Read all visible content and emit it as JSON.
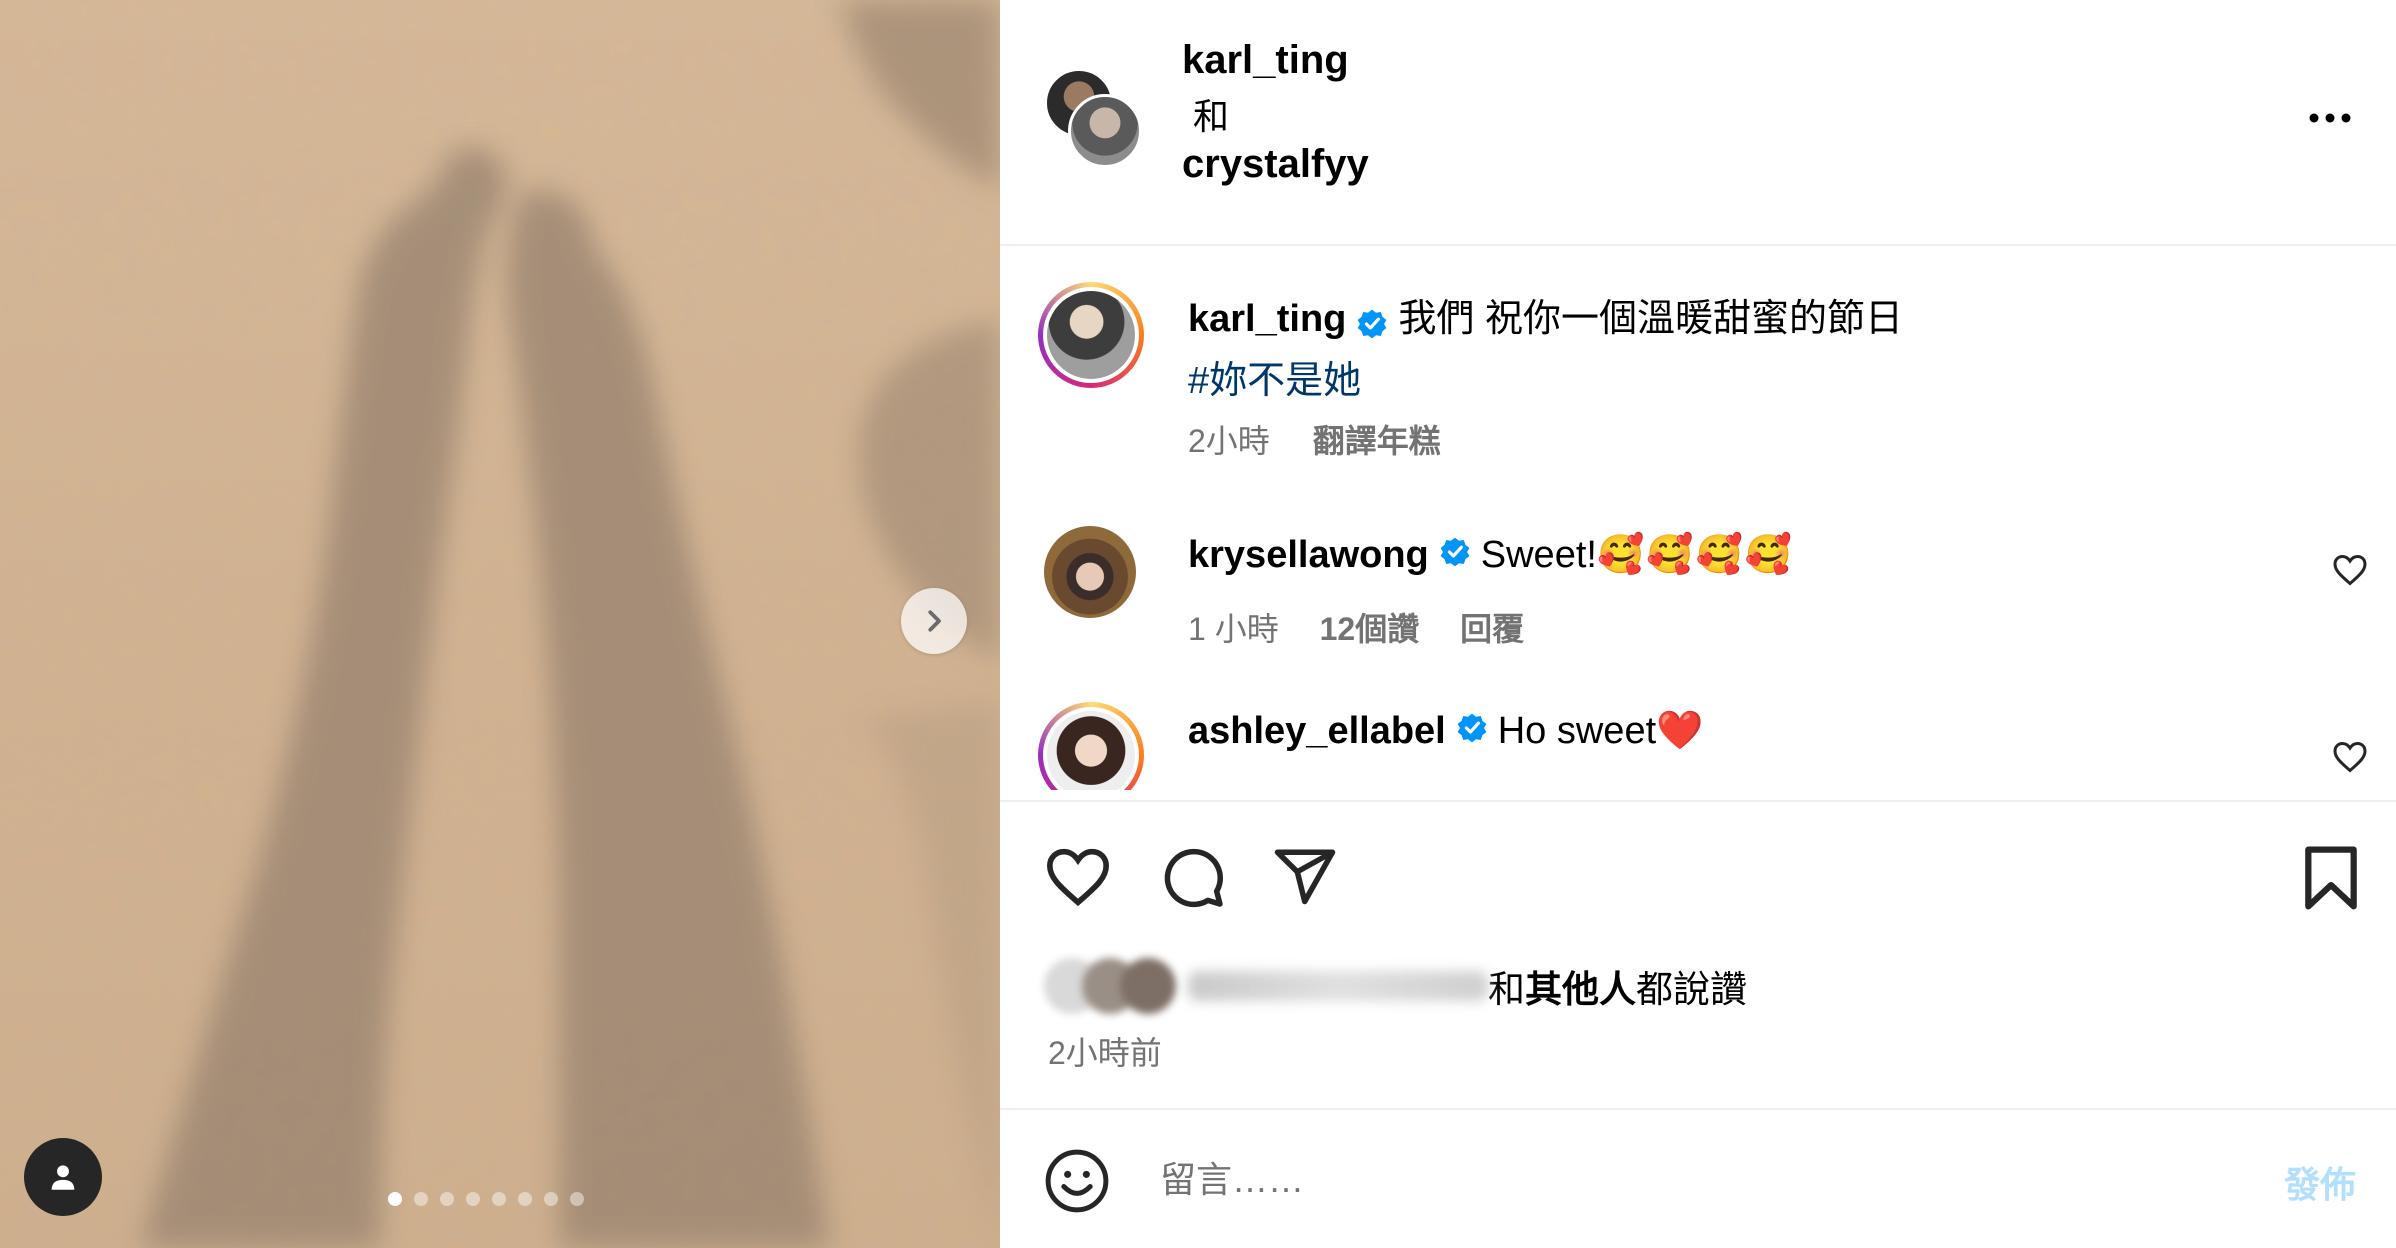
{
  "header": {
    "user1": "karl_ting",
    "and": "和",
    "user2": "crystalfyy"
  },
  "caption": {
    "username": "karl_ting",
    "text": "我們 祝你一個溫暖甜蜜的節日",
    "hashtag": "#妳不是她",
    "time": "2小時",
    "translate": "翻譯年糕"
  },
  "comments": [
    {
      "username": "krysellawong",
      "text": "Sweet!",
      "emoji": "🥰🥰🥰🥰",
      "time": "1 小時",
      "likes": "12個讚",
      "reply": "回覆"
    },
    {
      "username": "ashley_ellabel",
      "text": "Ho sweet",
      "emoji": "❤️"
    }
  ],
  "likes": {
    "suffix_plain": "和",
    "suffix_bold": "其他人",
    "suffix_end": "都說讚"
  },
  "timestamp": "2小時前",
  "compose": {
    "placeholder": "留言……",
    "post_label": "發佈"
  },
  "colors": {
    "verified": "#0095f6",
    "hashtag": "#00376b",
    "post_disabled": "#b2dffc",
    "secondary_text": "#737373"
  },
  "carousel": {
    "total": 8,
    "current": 1
  }
}
